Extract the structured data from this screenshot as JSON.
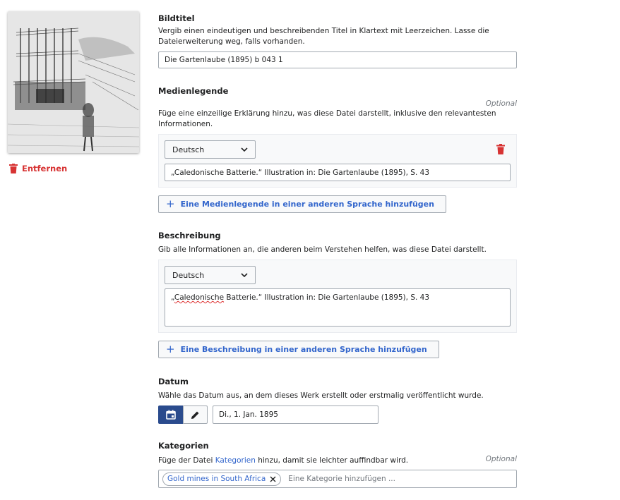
{
  "image": {
    "alt_icon": "engraving-thumbnail"
  },
  "remove": {
    "label": "Entfernen",
    "icon": "trash-icon",
    "color": "#d73333"
  },
  "title_section": {
    "heading": "Bildtitel",
    "help": "Vergib einen eindeutigen und beschreibenden Titel in Klartext mit Leerzeichen. Lasse die Dateierweiterung weg, falls vorhanden.",
    "value": "Die Gartenlaube (1895) b 043 1"
  },
  "caption_section": {
    "heading": "Medienlegende",
    "optional": "Optional",
    "help": "Füge eine einzeilige Erklärung hinzu, was diese Datei darstellt, inklusive den relevantesten Informationen.",
    "language": "Deutsch",
    "value": "„Caledonische Batterie.“ Illustration in: Die Gartenlaube (1895), S. 43",
    "add_label": "Eine Medienlegende in einer anderen Sprache hinzufügen"
  },
  "description_section": {
    "heading": "Beschreibung",
    "help": "Gib alle Informationen an, die anderen beim Verstehen helfen, was diese Datei darstellt.",
    "language": "Deutsch",
    "value_prefix": "„",
    "value_misspelled": "Caledonische",
    "value_rest": " Batterie.“ Illustration in: Die Gartenlaube (1895), S. 43",
    "add_label": "Eine Beschreibung in einer anderen Sprache hinzufügen"
  },
  "date_section": {
    "heading": "Datum",
    "help": "Wähle das Datum aus, an dem dieses Werk erstellt oder erstmalig veröffentlicht wurde.",
    "value": "Di., 1. Jan. 1895"
  },
  "category_section": {
    "heading": "Kategorien",
    "optional": "Optional",
    "help_prefix": "Füge der Datei ",
    "help_link": "Kategorien",
    "help_suffix": " hinzu, damit sie leichter auffindbar wird.",
    "chips": [
      "Gold mines in South Africa"
    ],
    "placeholder": "Eine Kategorie hinzufügen ..."
  },
  "colors": {
    "accent": "#3366cc",
    "progressive": "#36c",
    "danger": "#d73333",
    "calendar_active": "#2a4b8d"
  }
}
